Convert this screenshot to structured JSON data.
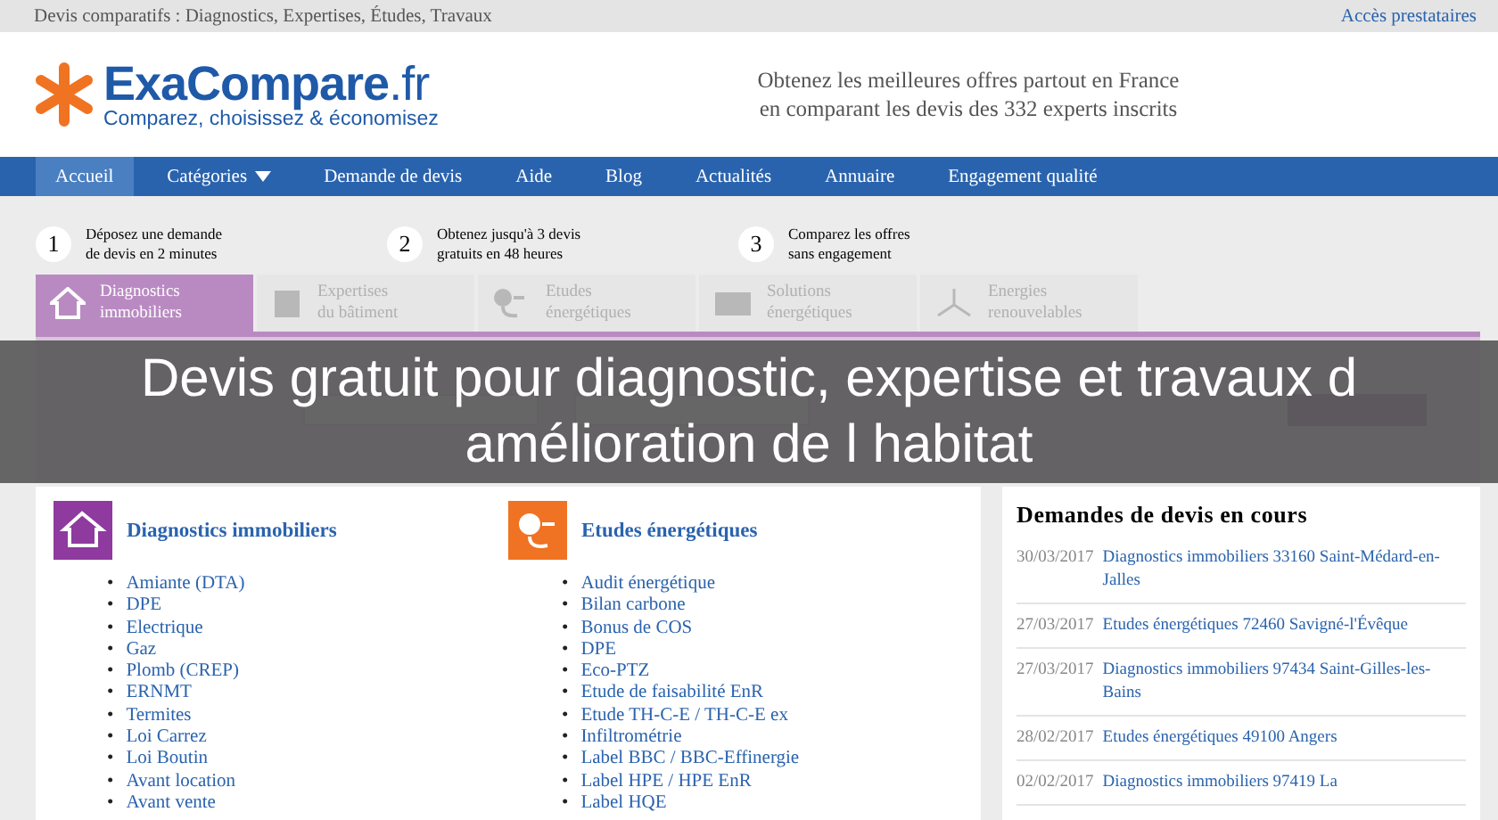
{
  "top_bar": {
    "breadcrumb": "Devis comparatifs : Diagnostics, Expertises, Études, Travaux",
    "link": "Accès prestataires"
  },
  "header": {
    "logo_name": "ExaCompare",
    "logo_tld": ".fr",
    "logo_tagline": "Comparez, choisissez & économisez",
    "slogan": [
      "Obtenez les meilleures offres partout en France",
      "en comparant les devis des 332 experts inscrits"
    ]
  },
  "nav": [
    {
      "label": "Accueil",
      "selected": true,
      "dropdown": false
    },
    {
      "label": "Catégories",
      "selected": false,
      "dropdown": true
    },
    {
      "label": "Demande de devis",
      "selected": false,
      "dropdown": false
    },
    {
      "label": "Aide",
      "selected": false,
      "dropdown": false
    },
    {
      "label": "Blog",
      "selected": false,
      "dropdown": false
    },
    {
      "label": "Actualités",
      "selected": false,
      "dropdown": false
    },
    {
      "label": "Annuaire",
      "selected": false,
      "dropdown": false
    },
    {
      "label": "Engagement qualité",
      "selected": false,
      "dropdown": false
    }
  ],
  "steps": [
    {
      "number": "1",
      "lines": [
        "Déposez une demande",
        "de devis en 2 minutes"
      ]
    },
    {
      "number": "2",
      "lines": [
        "Obtenez jusqu'à 3 devis",
        "gratuits en 48 heures"
      ]
    },
    {
      "number": "3",
      "lines": [
        "Comparez les offres",
        "sans engagement"
      ]
    }
  ],
  "category_tabs": [
    {
      "kind": "house",
      "lines": [
        "Diagnostics",
        "immobiliers"
      ],
      "selected": true
    },
    {
      "kind": "building",
      "lines": [
        "Expertises",
        "du bâtiment"
      ],
      "selected": false
    },
    {
      "kind": "plug",
      "lines": [
        "Etudes",
        "énergétiques"
      ],
      "selected": false
    },
    {
      "kind": "panel",
      "lines": [
        "Solutions",
        "énergétiques"
      ],
      "selected": false
    },
    {
      "kind": "turbine",
      "lines": [
        "Energies",
        "renouvelables"
      ],
      "selected": false
    }
  ],
  "caption": [
    "Devis gratuit pour diagnostic, expertise et travaux d",
    "amélioration de l habitat"
  ],
  "categories": [
    {
      "kind": "house",
      "color": "#8e3a9e",
      "bullet": "•",
      "title": "Diagnostics immobiliers",
      "items": [
        "Amiante (DTA)",
        "DPE",
        "Electrique",
        "Gaz",
        "Plomb (CREP)",
        "ERNMT",
        "Termites",
        "Loi Carrez",
        "Loi Boutin",
        "Avant location",
        "Avant vente"
      ]
    },
    {
      "kind": "plug",
      "color": "#ef7322",
      "bullet": "•",
      "title": "Etudes énergétiques",
      "items": [
        "Audit énergétique",
        "Bilan carbone",
        "Bonus de COS",
        "DPE",
        "Eco-PTZ",
        "Etude de faisabilité EnR",
        "Etude TH-C-E / TH-C-E ex",
        "Infiltrométrie",
        "Label BBC / BBC-Effinergie",
        "Label HPE / HPE EnR",
        "Label HQE"
      ]
    }
  ],
  "requests": {
    "title": "Demandes de devis en cours",
    "items": [
      {
        "date": "30/03/2017",
        "text": "Diagnostics immobiliers 33160 Saint-Médard-en-Jalles"
      },
      {
        "date": "27/03/2017",
        "text": "Etudes énergétiques 72460 Savigné-l'Évêque"
      },
      {
        "date": "27/03/2017",
        "text": "Diagnostics immobiliers 97434 Saint-Gilles-les-Bains"
      },
      {
        "date": "28/02/2017",
        "text": "Etudes énergétiques 49100 Angers"
      },
      {
        "date": "02/02/2017",
        "text": "Diagnostics immobiliers 97419 La"
      }
    ]
  }
}
